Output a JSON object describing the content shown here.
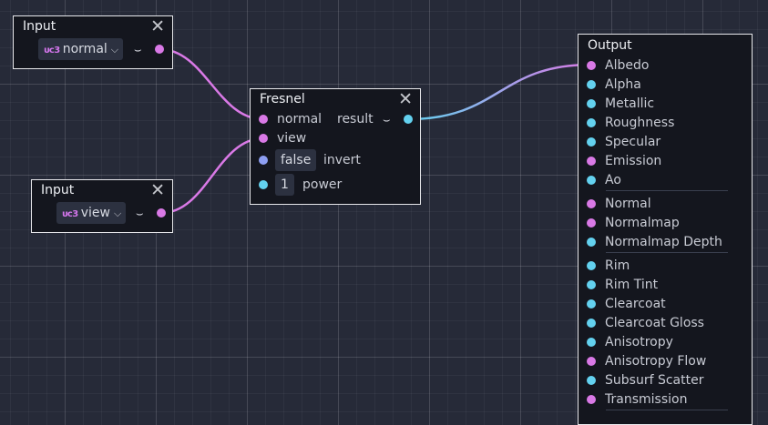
{
  "colors": {
    "pink_port": "#d979e6",
    "cyan_port": "#63d1ef",
    "blue_port": "#8d9ef2",
    "node_bg": "#14161e",
    "grid_bg": "#262a38"
  },
  "icons": {
    "close": "close-icon",
    "dropdown": "chevron-down-icon",
    "preview": "eye-preview-icon",
    "vector": "vec3-type-icon"
  },
  "nodes": {
    "input1": {
      "title": "Input",
      "close": "✕",
      "type_tag": "vec3",
      "value": "normal"
    },
    "input2": {
      "title": "Input",
      "close": "✕",
      "type_tag": "vec3",
      "value": "view"
    },
    "fresnel": {
      "title": "Fresnel",
      "close": "✕",
      "in_normal": "normal",
      "in_view": "view",
      "out_result": "result",
      "invert_value": "false",
      "invert_label": "invert",
      "power_value": "1",
      "power_label": "power"
    },
    "output": {
      "title": "Output",
      "ports": [
        "Albedo",
        "Alpha",
        "Metallic",
        "Roughness",
        "Specular",
        "Emission",
        "Ao",
        "Normal",
        "Normalmap",
        "Normalmap Depth",
        "Rim",
        "Rim Tint",
        "Clearcoat",
        "Clearcoat Gloss",
        "Anisotropy",
        "Anisotropy Flow",
        "Subsurf Scatter",
        "Transmission"
      ]
    }
  }
}
